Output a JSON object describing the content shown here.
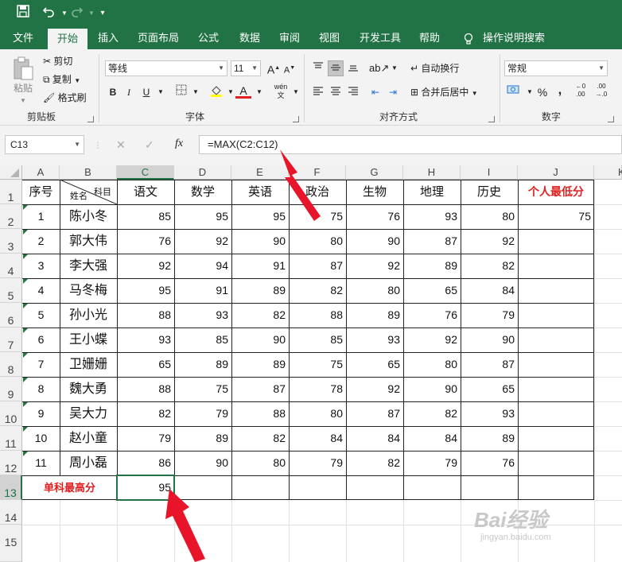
{
  "qat": {
    "save_icon": "save-icon",
    "undo_icon": "undo-icon",
    "redo_icon": "redo-icon",
    "customize_icon": "customize-icon"
  },
  "tabs": [
    {
      "label": "文件"
    },
    {
      "label": "开始"
    },
    {
      "label": "插入"
    },
    {
      "label": "页面布局"
    },
    {
      "label": "公式"
    },
    {
      "label": "数据"
    },
    {
      "label": "审阅"
    },
    {
      "label": "视图"
    },
    {
      "label": "开发工具"
    },
    {
      "label": "帮助"
    }
  ],
  "tell_me": "操作说明搜索",
  "ribbon": {
    "clipboard": {
      "paste": "粘贴",
      "cut": "剪切",
      "copy": "复制",
      "format_painter": "格式刷",
      "label": "剪贴板"
    },
    "font": {
      "name": "等线",
      "size": "11",
      "label": "字体",
      "bold": "B",
      "italic": "I",
      "underline": "U",
      "grow": "A",
      "shrink": "A",
      "phonetic": "wén"
    },
    "alignment": {
      "wrap": "自动换行",
      "merge": "合并后居中",
      "label": "对齐方式"
    },
    "number": {
      "format": "常规",
      "percent": "%",
      "comma": ",",
      "label": "数字"
    }
  },
  "formula_bar": {
    "name_box": "C13",
    "fx": "fx",
    "formula": "=MAX(C2:C12)"
  },
  "columns": [
    "A",
    "B",
    "C",
    "D",
    "E",
    "F",
    "G",
    "H",
    "I",
    "J",
    "K"
  ],
  "rows": [
    "1",
    "2",
    "3",
    "4",
    "5",
    "6",
    "7",
    "8",
    "9",
    "10",
    "11",
    "12",
    "13",
    "14",
    "15"
  ],
  "header": {
    "seq": "序号",
    "name_label": "姓名",
    "subject_label": "科目",
    "subjects": [
      "语文",
      "数学",
      "英语",
      "政治",
      "生物",
      "地理",
      "历史"
    ],
    "min_label": "个人最低分"
  },
  "students": [
    {
      "seq": "1",
      "name": "陈小冬",
      "scores": [
        "85",
        "95",
        "95",
        "75",
        "76",
        "93",
        "80"
      ],
      "min": "75"
    },
    {
      "seq": "2",
      "name": "郭大伟",
      "scores": [
        "76",
        "92",
        "90",
        "80",
        "90",
        "87",
        "92"
      ],
      "min": ""
    },
    {
      "seq": "3",
      "name": "李大强",
      "scores": [
        "92",
        "94",
        "91",
        "87",
        "92",
        "89",
        "82"
      ],
      "min": ""
    },
    {
      "seq": "4",
      "name": "马冬梅",
      "scores": [
        "95",
        "91",
        "89",
        "82",
        "80",
        "65",
        "84"
      ],
      "min": ""
    },
    {
      "seq": "5",
      "name": "孙小光",
      "scores": [
        "88",
        "93",
        "82",
        "88",
        "89",
        "76",
        "79"
      ],
      "min": ""
    },
    {
      "seq": "6",
      "name": "王小蝶",
      "scores": [
        "93",
        "85",
        "90",
        "85",
        "93",
        "92",
        "90"
      ],
      "min": ""
    },
    {
      "seq": "7",
      "name": "卫姗姗",
      "scores": [
        "65",
        "89",
        "89",
        "75",
        "65",
        "80",
        "87"
      ],
      "min": ""
    },
    {
      "seq": "8",
      "name": "魏大勇",
      "scores": [
        "88",
        "75",
        "87",
        "78",
        "92",
        "90",
        "65"
      ],
      "min": ""
    },
    {
      "seq": "9",
      "name": "吴大力",
      "scores": [
        "82",
        "79",
        "88",
        "80",
        "87",
        "82",
        "93"
      ],
      "min": ""
    },
    {
      "seq": "10",
      "name": "赵小童",
      "scores": [
        "79",
        "89",
        "82",
        "84",
        "84",
        "84",
        "89"
      ],
      "min": ""
    },
    {
      "seq": "11",
      "name": "周小磊",
      "scores": [
        "86",
        "90",
        "80",
        "79",
        "82",
        "79",
        "76"
      ],
      "min": ""
    }
  ],
  "footer": {
    "label": "单科最高分",
    "c13": "95"
  },
  "colors": {
    "accent": "#217346",
    "red_label": "#e02020",
    "arrow": "#e8152a"
  },
  "watermark": {
    "brand": "Bai经验",
    "url": "jingyan.baidu.com"
  }
}
